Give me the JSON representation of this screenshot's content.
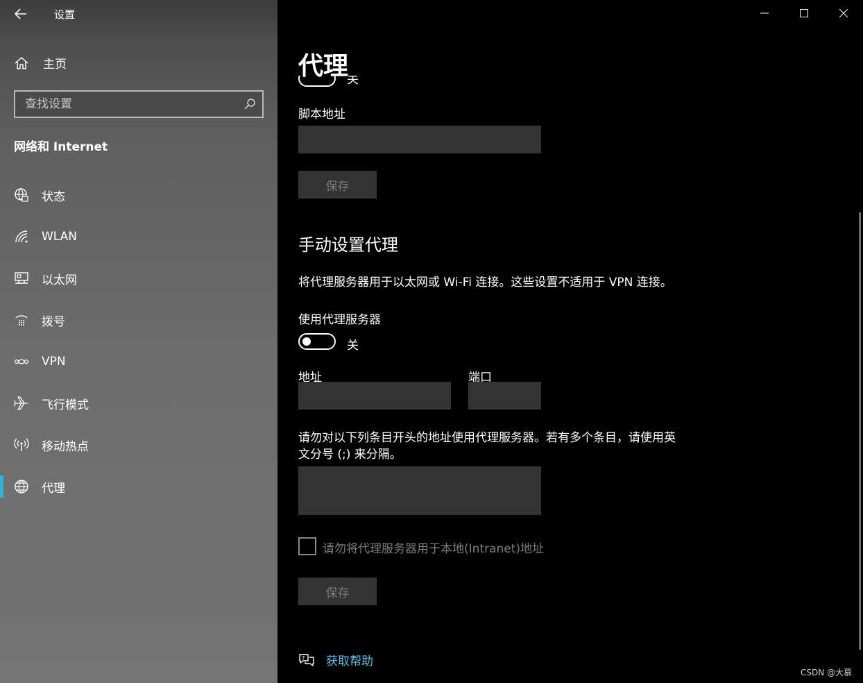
{
  "app": {
    "title": "设置"
  },
  "sidebar": {
    "home_label": "主页",
    "search_placeholder": "查找设置",
    "section_title": "网络和 Internet",
    "items": [
      {
        "label": "状态",
        "icon": "globe-status-icon"
      },
      {
        "label": "WLAN",
        "icon": "wifi-icon"
      },
      {
        "label": "以太网",
        "icon": "ethernet-icon"
      },
      {
        "label": "拨号",
        "icon": "dialup-icon"
      },
      {
        "label": "VPN",
        "icon": "vpn-icon"
      },
      {
        "label": "飞行模式",
        "icon": "airplane-icon"
      },
      {
        "label": "移动热点",
        "icon": "hotspot-icon"
      },
      {
        "label": "代理",
        "icon": "globe-icon",
        "selected": true
      }
    ],
    "accent_color": "#2fb3d6"
  },
  "content": {
    "page_title": "代理",
    "auto": {
      "toggle_state": "关",
      "script_label": "脚本地址",
      "script_value": "",
      "save_label": "保存"
    },
    "manual": {
      "heading": "手动设置代理",
      "description": "将代理服务器用于以太网或 Wi-Fi 连接。这些设置不适用于 VPN 连接。",
      "use_proxy_label": "使用代理服务器",
      "toggle_state": "关",
      "toggle_on": false,
      "address_label": "地址",
      "address_value": "",
      "port_label": "端口",
      "port_value": "",
      "exceptions_label_line1": "请勿对以下列条目开头的地址使用代理服务器。若有多个条目，请使用英",
      "exceptions_label_line2": "文分号 (;) 来分隔。",
      "exceptions_value": "",
      "local_checkbox_label": "请勿将代理服务器用于本地(Intranet)地址",
      "local_checkbox_checked": false,
      "save_label": "保存"
    },
    "help_label": "获取帮助",
    "link_color": "#4cc2e8"
  },
  "watermark": "CSDN @大慕"
}
